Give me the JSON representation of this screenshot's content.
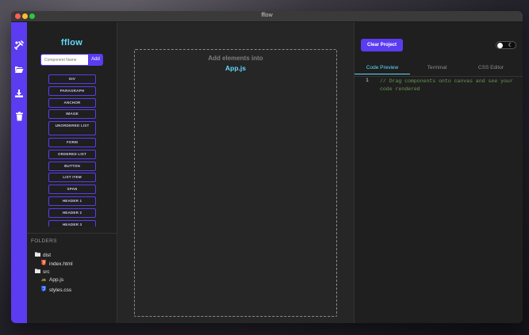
{
  "window": {
    "title": "fflow"
  },
  "iconbar": {
    "items": [
      {
        "icon": "tools-icon"
      },
      {
        "icon": "folder-open-icon"
      },
      {
        "icon": "download-icon"
      },
      {
        "icon": "trash-icon"
      }
    ]
  },
  "sidebar": {
    "logo": "fflow",
    "component_input": {
      "placeholder": "Component Name",
      "value": ""
    },
    "add_label": "Add",
    "elements": [
      "DIV",
      "PARAGRAPH",
      "ANCHOR",
      "IMAGE",
      "UNORDERED LIST",
      "FORM",
      "ORDERED LIST",
      "BUTTON",
      "LIST ITEM",
      "SPAN",
      "HEADER 1",
      "HEADER 2",
      "HEADER 3"
    ],
    "folders_title": "FOLDERS",
    "tree": {
      "dist": "dist",
      "index_html": "index.html",
      "src": "src",
      "app_js": "App.js",
      "styles_css": "styles.css"
    }
  },
  "canvas": {
    "hint": "Add elements into",
    "file": "App.js"
  },
  "right": {
    "clear_label": "Clear Project",
    "theme_toggle": "dark",
    "tabs": [
      "Code Preview",
      "Terminal",
      "CSS Editor"
    ],
    "active_tab": "Code Preview",
    "line_number": "1",
    "code": "// Drag components onto canvas and see your code rendered"
  },
  "colors": {
    "accent": "#5b3cf0",
    "logo": "#61dafb",
    "comment": "#6a9955"
  }
}
